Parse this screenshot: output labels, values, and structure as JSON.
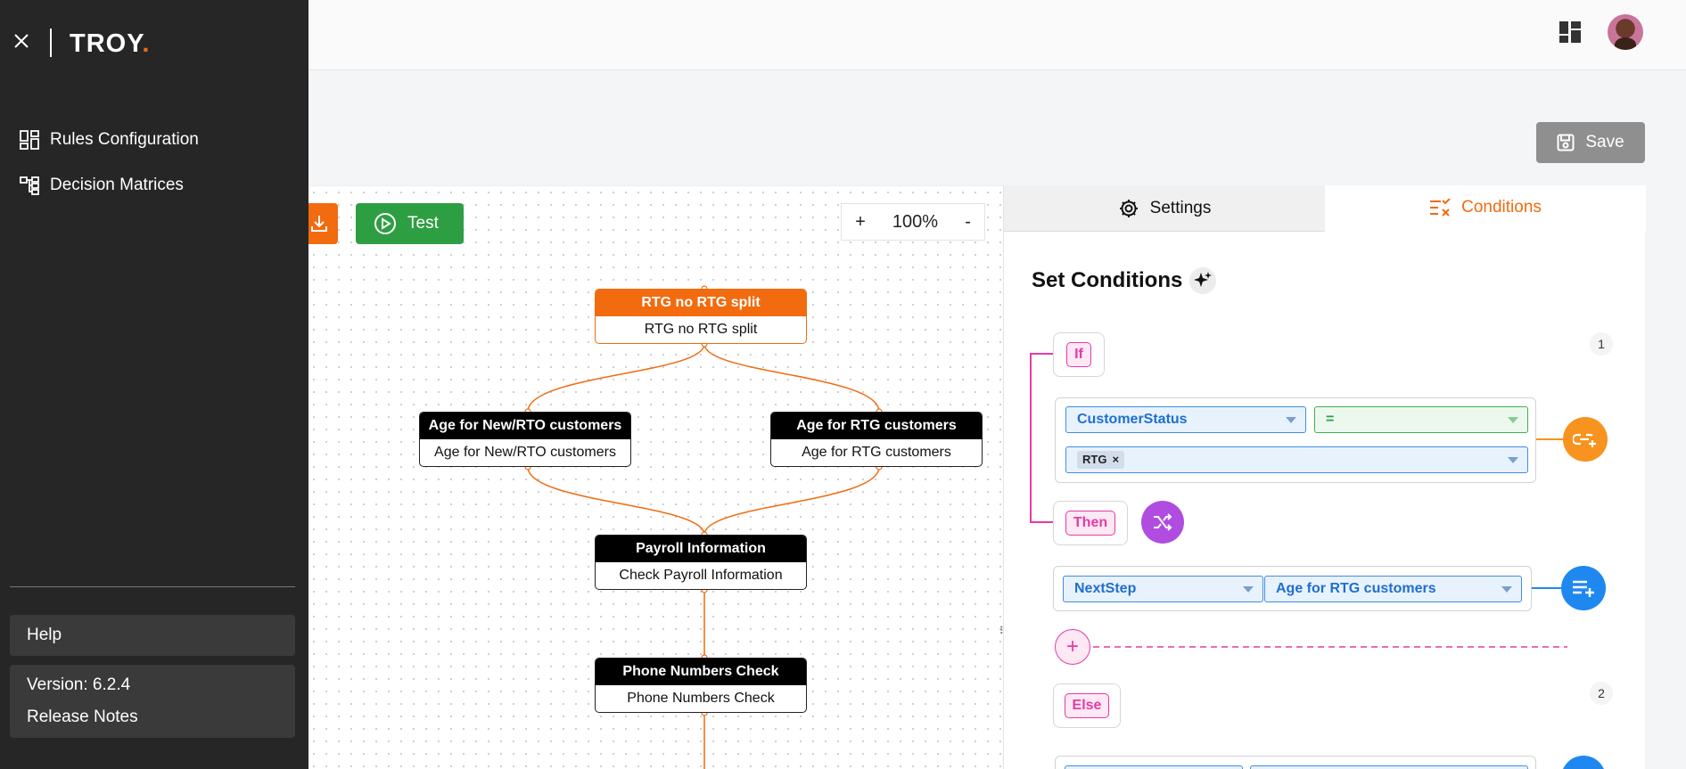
{
  "sidebar": {
    "brand": "TROY",
    "brand_dot": ".",
    "items": [
      {
        "label": "Rules Configuration",
        "icon": "dashboard-icon"
      },
      {
        "label": "Decision Matrices",
        "icon": "hierarchy-icon"
      }
    ],
    "help_label": "Help",
    "version": "Version: 6.2.4",
    "release_notes": "Release Notes"
  },
  "header": {
    "apps_icon": "apps-grid-icon",
    "avatar": "user-avatar"
  },
  "toolbar": {
    "save_label": "Save",
    "test_label": "Test",
    "zoom_in": "+",
    "zoom_level": "100%",
    "zoom_out": "-"
  },
  "flow": {
    "nodes": [
      {
        "title": "RTG no RTG split",
        "body": "RTG no RTG split"
      },
      {
        "title": "Age for New/RTO customers",
        "body": "Age for New/RTO customers"
      },
      {
        "title": "Age for RTG customers",
        "body": "Age for RTG customers"
      },
      {
        "title": "Payroll Information",
        "body": "Check Payroll Information"
      },
      {
        "title": "Phone Numbers Check",
        "body": "Phone Numbers Check"
      }
    ]
  },
  "panel": {
    "tabs": [
      {
        "label": "Settings",
        "icon": "gear-icon"
      },
      {
        "label": "Conditions",
        "icon": "checklist-icon"
      }
    ],
    "title": "Set Conditions",
    "if_label": "If",
    "then_label": "Then",
    "else_label": "Else",
    "block_numbers": [
      "1",
      "2"
    ],
    "condition": {
      "field": "CustomerStatus",
      "operator": "=",
      "value_chip": "RTG",
      "chip_remove": "×"
    },
    "action": {
      "field": "NextStep",
      "value": "Age for RTG customers"
    },
    "add_symbol": "+"
  },
  "colors": {
    "accent": "#f26b0f",
    "test_green": "#2e9e43",
    "condition_pink": "#e43aa6",
    "link_orange": "#f7931e",
    "shuffle_purple": "#b04de0",
    "add_blue": "#1e88f0",
    "sidebar_bg": "#262626"
  }
}
